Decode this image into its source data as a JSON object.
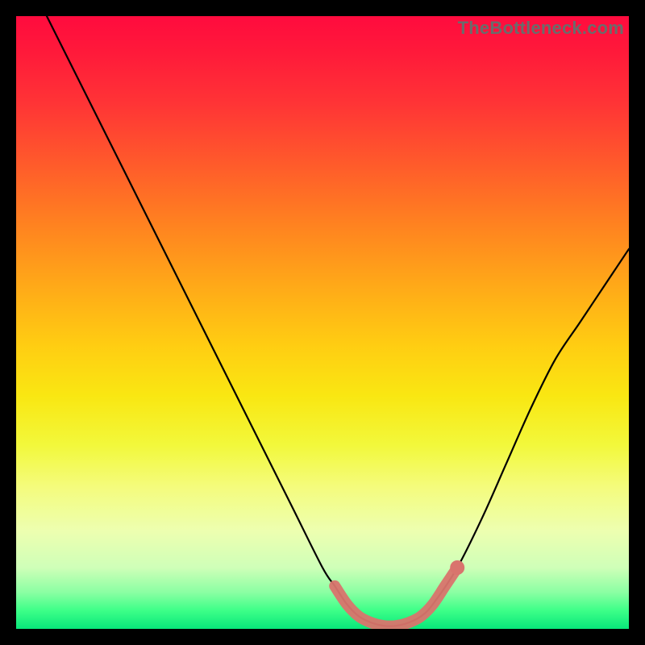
{
  "watermark": "TheBottleneck.com",
  "chart_data": {
    "type": "line",
    "title": "",
    "xlabel": "",
    "ylabel": "",
    "xlim": [
      0,
      100
    ],
    "ylim": [
      0,
      100
    ],
    "grid": false,
    "series": [
      {
        "name": "curve",
        "color": "#000000",
        "x": [
          5,
          10,
          15,
          20,
          25,
          30,
          35,
          40,
          45,
          50,
          52,
          54,
          56,
          58,
          60,
          62,
          64,
          66,
          68,
          72,
          76,
          80,
          84,
          88,
          92,
          96,
          100
        ],
        "y": [
          100,
          90,
          80,
          70,
          60,
          50,
          40,
          30,
          20,
          10,
          7,
          4,
          2,
          1,
          0.5,
          0.5,
          1,
          2,
          4,
          10,
          18,
          27,
          36,
          44,
          50,
          56,
          62
        ]
      },
      {
        "name": "highlight-band",
        "color": "#d9746d",
        "x": [
          52,
          54,
          56,
          58,
          60,
          62,
          64,
          66,
          68,
          70,
          72
        ],
        "y": [
          7,
          4,
          2,
          1,
          0.5,
          0.5,
          1,
          2,
          4,
          7,
          10
        ]
      }
    ],
    "highlight_dot": {
      "x": 72,
      "y": 10,
      "color": "#d9746d"
    }
  }
}
